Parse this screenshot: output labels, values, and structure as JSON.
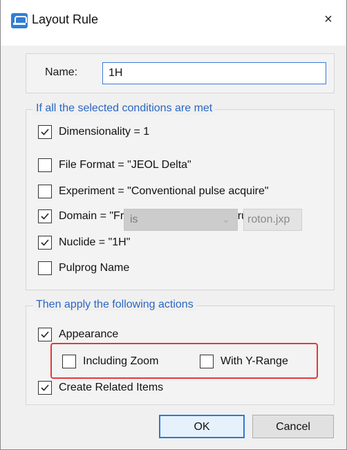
{
  "window": {
    "title": "Layout Rule",
    "close_glyph": "×"
  },
  "name_field": {
    "label": "Name:",
    "value": "1H"
  },
  "conditions": {
    "legend": "If all the selected conditions are met",
    "items": [
      {
        "label": "Dimensionality = 1",
        "checked": true
      },
      {
        "label": "File Format = \"JEOL Delta\"",
        "checked": false
      },
      {
        "label": "Experiment = \"Conventional pulse acquire\"",
        "checked": false
      },
      {
        "label": "Domain = \"Frequency domain, spectrum\"",
        "checked": true
      },
      {
        "label": "Nuclide = \"1H\"",
        "checked": true
      },
      {
        "label": "Pulprog Name",
        "checked": false
      }
    ],
    "pulprog_operator": "is",
    "pulprog_value": "roton.jxp"
  },
  "actions": {
    "legend": "Then apply the following actions",
    "appearance": {
      "label": "Appearance",
      "checked": true
    },
    "including_zoom": {
      "label": "Including Zoom",
      "checked": false
    },
    "with_y_range": {
      "label": "With Y-Range",
      "checked": false
    },
    "create_related": {
      "label": "Create Related Items",
      "checked": true
    }
  },
  "buttons": {
    "ok": "OK",
    "cancel": "Cancel"
  },
  "colors": {
    "accent": "#2a66c2",
    "highlight": "#e03a3a"
  }
}
